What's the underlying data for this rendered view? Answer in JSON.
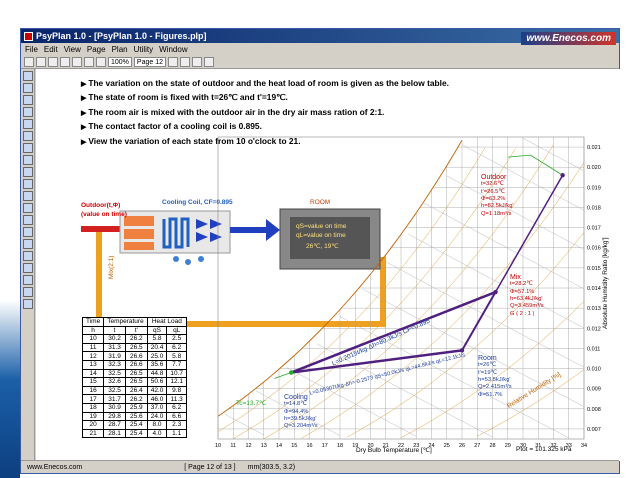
{
  "window": {
    "title": "PsyPlan 1.0 - [PsyPlan 1.0 - Figures.plp]",
    "logo": "www.Enecos.com"
  },
  "menu": [
    "File",
    "Edit",
    "View",
    "Page",
    "Plan",
    "Utility",
    "Window"
  ],
  "toolbar": {
    "zoom": "100%",
    "page": "Page 12"
  },
  "bullets": [
    "The variation on the state of outdoor and the heat load of room is given as the below table.",
    "The state of room is fixed with t=26℃ and t'=19℃.",
    "The room air is mixed with the outdoor air in the dry air mass ration of 2:1.",
    "The contact factor of a cooling coil is 0.895.",
    "View the variation of each state from 10 o'clock to 21."
  ],
  "diagram": {
    "outdoor_label": "Outdoor(t,Φ)",
    "outdoor_sub": "(value on time)",
    "coil_label": "Cooling Coil, CF=0.895",
    "room_label": "ROOM",
    "room_text1": "qS=value on time",
    "room_text2": "qL=value on time",
    "room_text3": "26℃, 19℃",
    "mix_label": "Mix(2:1)"
  },
  "table": {
    "header1": [
      "Time",
      "Temperature",
      "Heat Load"
    ],
    "header2": [
      "h",
      "t",
      "t'",
      "qS",
      "qL"
    ],
    "rows": [
      [
        "10",
        "30.2",
        "26.2",
        "5.8",
        "2.5"
      ],
      [
        "11",
        "31.3",
        "26.5",
        "20.4",
        "6.2"
      ],
      [
        "12",
        "31.9",
        "26.6",
        "25.0",
        "5.8"
      ],
      [
        "13",
        "32.3",
        "26.6",
        "35.6",
        "7.7"
      ],
      [
        "14",
        "32.5",
        "26.5",
        "44.8",
        "10.7"
      ],
      [
        "15",
        "32.6",
        "26.5",
        "50.6",
        "12.1"
      ],
      [
        "16",
        "32.5",
        "26.4",
        "42.0",
        "9.8"
      ],
      [
        "17",
        "31.7",
        "26.2",
        "46.0",
        "11.3"
      ],
      [
        "18",
        "30.9",
        "25.9",
        "37.0",
        "6.2"
      ],
      [
        "19",
        "29.8",
        "25.6",
        "24.0",
        "6.6"
      ],
      [
        "20",
        "28.7",
        "25.4",
        "8.0",
        "2.3"
      ],
      [
        "21",
        "28.1",
        "25.4",
        "4.0",
        "1.1"
      ]
    ]
  },
  "chart": {
    "xlabel": "Dry Bulb Temperature [℃]",
    "ylabel": "Absolute Humidity Ratio [kg/kg']",
    "pressure": "Ptot = 101.325 kPa",
    "rh_label": "Relative Humidity [%]",
    "xticks": [
      "10",
      "11",
      "12",
      "13",
      "14",
      "15",
      "16",
      "17",
      "18",
      "19",
      "20",
      "21",
      "22",
      "23",
      "24",
      "25",
      "26",
      "27",
      "28",
      "29",
      "30",
      "31",
      "32",
      "33",
      "34"
    ],
    "yticks": [
      "0.021",
      "0.020",
      "0.019",
      "0.018",
      "0.017",
      "0.016",
      "0.015",
      "0.014",
      "0.013",
      "0.012",
      "0.011",
      "0.010",
      "0.009",
      "0.008",
      "0.007"
    ],
    "outdoor": [
      "Outdoor",
      "t=32.6℃",
      "t'=26.5℃",
      "Φ=63.2%",
      "h=82.5kJ/kg'",
      "Q=1.18m³/s"
    ],
    "mix": [
      "Mix",
      "t=28.2℃",
      "Φ=57.1%",
      "h=63.4kJ/kg'",
      "Q=3.459m³/s",
      "G ( 2 : 1 )"
    ],
    "room": [
      "Room",
      "t=26℃",
      "t'=19℃",
      "h=53.5kJ/kg'",
      "Q=2.415m³/s",
      "Φ=51.7%"
    ],
    "cooling": [
      "Cooling",
      "t=14.8℃",
      "Φ=94.4%",
      "h=39.5kJ/kg'",
      "Q=3.204m³/s"
    ],
    "coil_load": "L=0.2015t/kg·Δh=80.3kJ/s CF=0.895",
    "room_load": "L=0.05307t/kg·Δh=-0.2573 qS=50.0kJ/s qL=44.8kJ/s qL=12.1kJ/s",
    "sensible_text": "Tc=13.7℃"
  },
  "status": {
    "site": "www.Enecos.com",
    "page": "[ Page 12 of 13 ]",
    "coords": "mm(303.5, 3.2)"
  }
}
